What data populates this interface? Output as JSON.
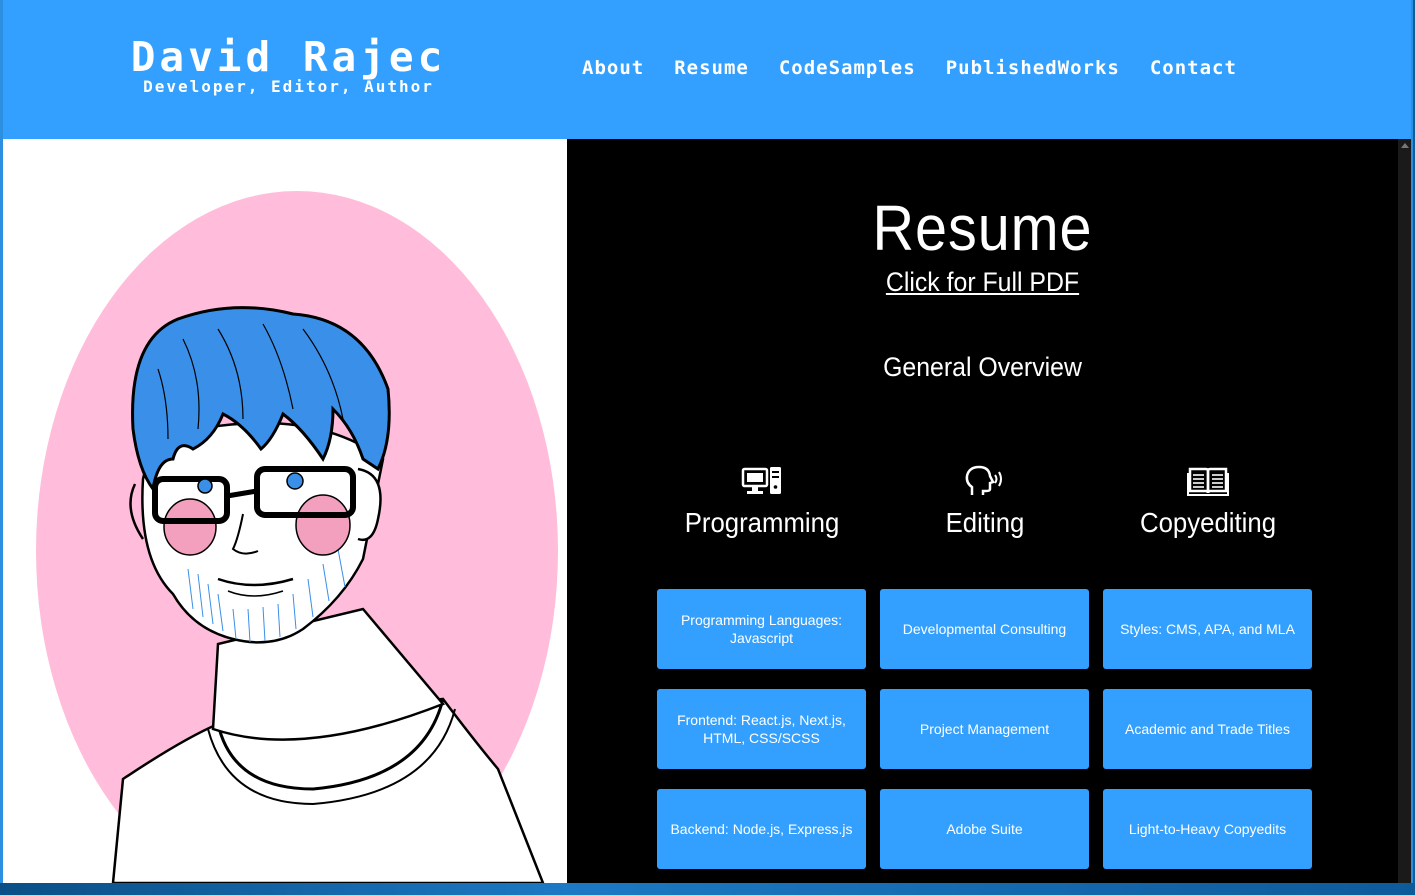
{
  "header": {
    "name": "David Rajec",
    "tagline": "Developer, Editor, Author",
    "nav": [
      "About",
      "Resume",
      "CodeSamples",
      "PublishedWorks",
      "Contact"
    ]
  },
  "resume": {
    "title": "Resume",
    "pdf_link": "Click for Full PDF",
    "overview_heading": "General Overview",
    "categories": [
      {
        "label": "Programming",
        "icon": "computer-icon"
      },
      {
        "label": "Editing",
        "icon": "speaking-head-icon"
      },
      {
        "label": "Copyediting",
        "icon": "open-book-icon"
      }
    ],
    "skills": [
      [
        "Programming Languages: Javascript",
        "Developmental Consulting",
        "Styles: CMS, APA, and MLA"
      ],
      [
        "Frontend: React.js, Next.js, HTML, CSS/SCSS",
        "Project Management",
        "Academic and Trade Titles"
      ],
      [
        "Backend: Node.js, Express.js",
        "Adobe Suite",
        "Light-to-Heavy Copyedits"
      ]
    ]
  },
  "colors": {
    "accent": "#33a0ff",
    "panel": "#000000",
    "portrait_circle": "#ffbddb",
    "hair": "#3a8fe8"
  }
}
